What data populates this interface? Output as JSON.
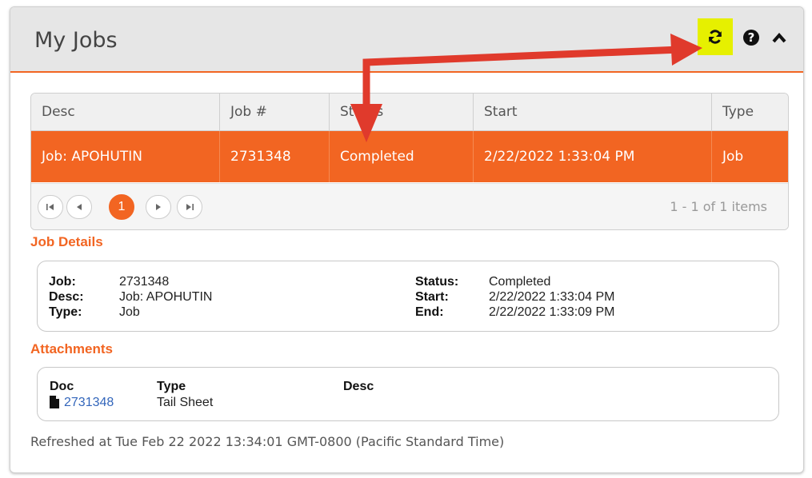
{
  "panel": {
    "title": "My Jobs",
    "icons": {
      "refresh": "refresh-icon",
      "help": "question-icon",
      "collapse": "chevron-up-icon"
    },
    "help_glyph": "?"
  },
  "grid": {
    "columns": [
      "Desc",
      "Job #",
      "Status",
      "Start",
      "Type"
    ],
    "rows": [
      {
        "desc": "Job: APOHUTIN",
        "job_no": "2731348",
        "status": "Completed",
        "start": "2/22/2022 1:33:04 PM",
        "type": "Job"
      }
    ],
    "pager": {
      "current_page": "1",
      "info": "1 - 1 of 1 items"
    }
  },
  "job_details": {
    "title": "Job Details",
    "labels": {
      "job": "Job:",
      "desc": "Desc:",
      "type": "Type:",
      "status": "Status:",
      "start": "Start:",
      "end": "End:"
    },
    "values": {
      "job": "2731348",
      "desc": "Job: APOHUTIN",
      "type": "Job",
      "status": "Completed",
      "start": "2/22/2022 1:33:04 PM",
      "end": "2/22/2022 1:33:09 PM"
    }
  },
  "attachments": {
    "title": "Attachments",
    "columns": [
      "Doc",
      "Type",
      "Desc"
    ],
    "rows": [
      {
        "doc": "2731348",
        "type": "Tail Sheet",
        "desc": ""
      }
    ]
  },
  "footer": {
    "refreshed": "Refreshed at Tue Feb 22 2022 13:34:01 GMT-0800 (Pacific Standard Time)"
  },
  "colors": {
    "accent": "#f26522",
    "highlight": "#e6f000",
    "annotation_arrow": "#e03a2c",
    "link": "#3366bb"
  }
}
